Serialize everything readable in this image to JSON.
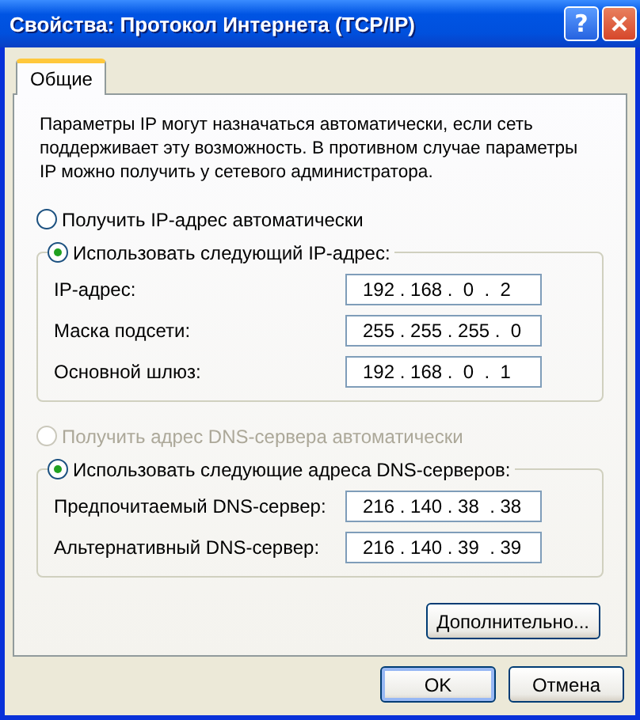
{
  "window": {
    "title": "Свойства: Протокол Интернета (TCP/IP)",
    "help_glyph": "?"
  },
  "tabs": [
    {
      "label": "Общие",
      "selected": true
    }
  ],
  "intro": "Параметры IP могут назначаться автоматически, если сеть поддерживает эту возможность. В противном случае параметры IP можно получить у сетевого администратора.",
  "ip_section": {
    "auto_option": {
      "label": "Получить IP-адрес автоматически",
      "selected": false,
      "disabled": false
    },
    "manual_option": {
      "label": "Использовать следующий IP-адрес:",
      "selected": true,
      "disabled": false
    },
    "fields": [
      {
        "label": "IP-адрес:",
        "value": "192 . 168 .  0  .  2"
      },
      {
        "label": "Маска подсети:",
        "value": "255 . 255 . 255 .  0"
      },
      {
        "label": "Основной шлюз:",
        "value": "192 . 168 .  0  .  1"
      }
    ]
  },
  "dns_section": {
    "auto_option": {
      "label": "Получить адрес DNS-сервера автоматически",
      "selected": false,
      "disabled": true
    },
    "manual_option": {
      "label": "Использовать следующие адреса DNS-серверов:",
      "selected": true,
      "disabled": false
    },
    "fields": [
      {
        "label": "Предпочитаемый DNS-сервер:",
        "value": "216 . 140 . 38  . 38"
      },
      {
        "label": "Альтернативный DNS-сервер:",
        "value": "216 . 140 . 39  . 39"
      }
    ]
  },
  "advanced_button": "Дополнительно...",
  "buttons": [
    {
      "label": "OK",
      "default": true
    },
    {
      "label": "Отмена",
      "default": false
    }
  ]
}
